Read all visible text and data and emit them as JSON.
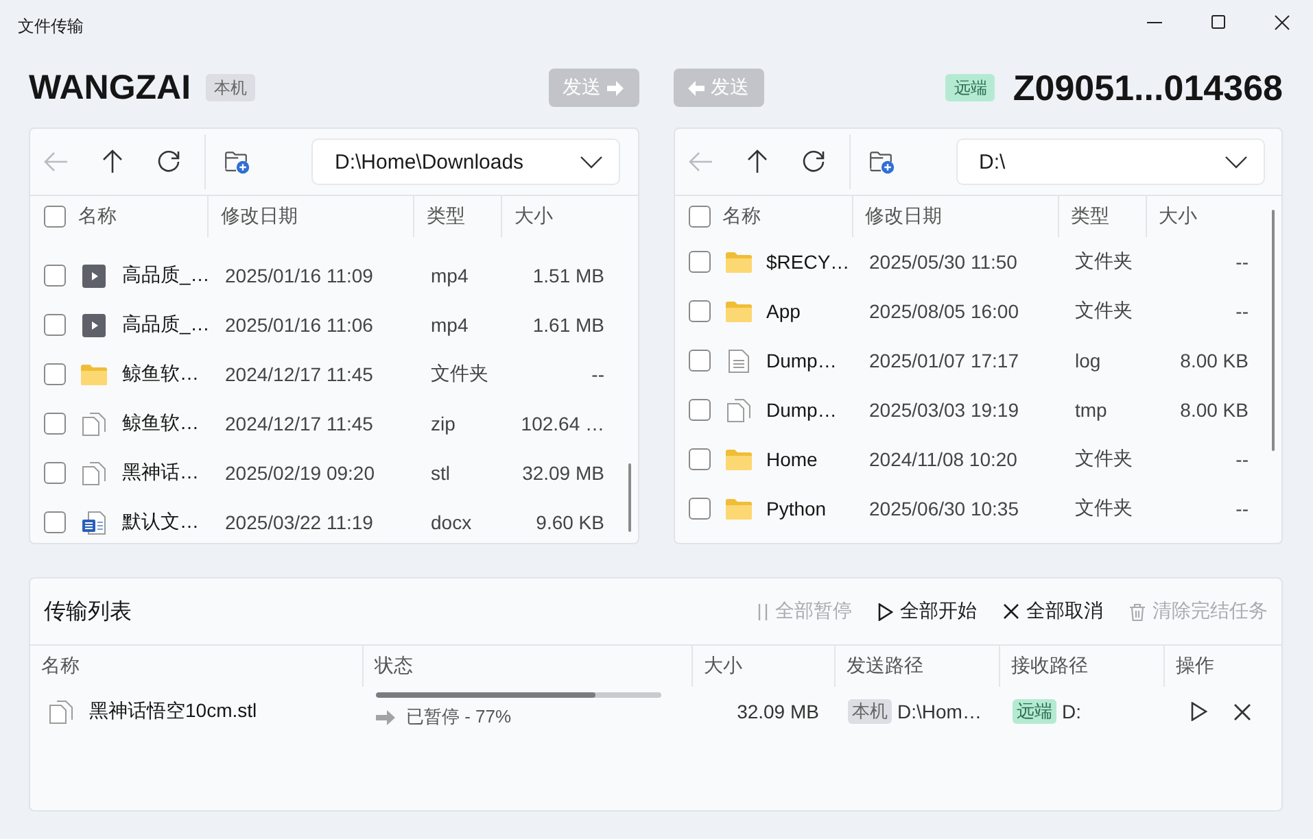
{
  "window": {
    "title": "文件传输"
  },
  "local": {
    "name": "WANGZAI",
    "badge": "本机"
  },
  "send_buttons": [
    {
      "kind": "to-right",
      "label": "发送",
      "disabled": true
    },
    {
      "kind": "to-left",
      "label": "发送",
      "disabled": true
    }
  ],
  "remote": {
    "badge": "远端",
    "name": "Z09051...014368"
  },
  "panes": [
    {
      "back_disabled": true,
      "path": "D:\\Home\\Downloads",
      "select_all_checked": false,
      "columns": [
        "名称",
        "修改日期",
        "类型",
        "大小"
      ],
      "rows": [
        {
          "kind": "video",
          "name": "高品质_…",
          "date": "2025/01/16 11:09",
          "type": "mp4",
          "size": "1.51 MB",
          "checked": false
        },
        {
          "kind": "video",
          "name": "高品质_…",
          "date": "2025/01/16 11:06",
          "type": "mp4",
          "size": "1.61 MB",
          "checked": false
        },
        {
          "kind": "folder",
          "name": "鲸鱼软…",
          "date": "2024/12/17 11:45",
          "type": "文件夹",
          "size": "--",
          "checked": false
        },
        {
          "kind": "file",
          "name": "鲸鱼软…",
          "date": "2024/12/17 11:45",
          "type": "zip",
          "size": "102.64 …",
          "checked": false
        },
        {
          "kind": "file",
          "name": "黑神话…",
          "date": "2025/02/19 09:20",
          "type": "stl",
          "size": "32.09 MB",
          "checked": false
        },
        {
          "kind": "word",
          "name": "默认文…",
          "date": "2025/03/22 11:19",
          "type": "docx",
          "size": "9.60 KB",
          "checked": false
        }
      ]
    },
    {
      "back_disabled": true,
      "path": "D:\\",
      "select_all_checked": false,
      "columns": [
        "名称",
        "修改日期",
        "类型",
        "大小"
      ],
      "rows": [
        {
          "kind": "folder",
          "name": "$RECY…",
          "date": "2025/05/30 11:50",
          "type": "文件夹",
          "size": "--",
          "checked": false
        },
        {
          "kind": "folder",
          "name": "App",
          "date": "2025/08/05 16:00",
          "type": "文件夹",
          "size": "--",
          "checked": false
        },
        {
          "kind": "text",
          "name": "Dump…",
          "date": "2025/01/07 17:17",
          "type": "log",
          "size": "8.00 KB",
          "checked": false
        },
        {
          "kind": "file",
          "name": "Dump…",
          "date": "2025/03/03 19:19",
          "type": "tmp",
          "size": "8.00 KB",
          "checked": false
        },
        {
          "kind": "folder",
          "name": "Home",
          "date": "2024/11/08 10:20",
          "type": "文件夹",
          "size": "--",
          "checked": false
        },
        {
          "kind": "folder",
          "name": "Python",
          "date": "2025/06/30 10:35",
          "type": "文件夹",
          "size": "--",
          "checked": false
        }
      ]
    }
  ],
  "transfers": {
    "title": "传输列表",
    "actions": [
      {
        "kind": "pause",
        "label": "全部暂停",
        "disabled": true
      },
      {
        "kind": "start",
        "label": "全部开始",
        "disabled": false
      },
      {
        "kind": "cancel",
        "label": "全部取消",
        "disabled": false
      },
      {
        "kind": "clear",
        "label": "清除完结任务",
        "disabled": true
      }
    ],
    "columns": [
      "名称",
      "状态",
      "大小",
      "发送路径",
      "接收路径",
      "操作"
    ],
    "rows": [
      {
        "kind": "file",
        "name": "黑神话悟空10cm.stl",
        "level": 0.77,
        "status": "已暂停 - 77%",
        "size": "32.09 MB",
        "source": {
          "badge": "本机",
          "path": "D:\\Hom…"
        },
        "target": {
          "badge": "远端",
          "path": "D:"
        }
      }
    ]
  }
}
